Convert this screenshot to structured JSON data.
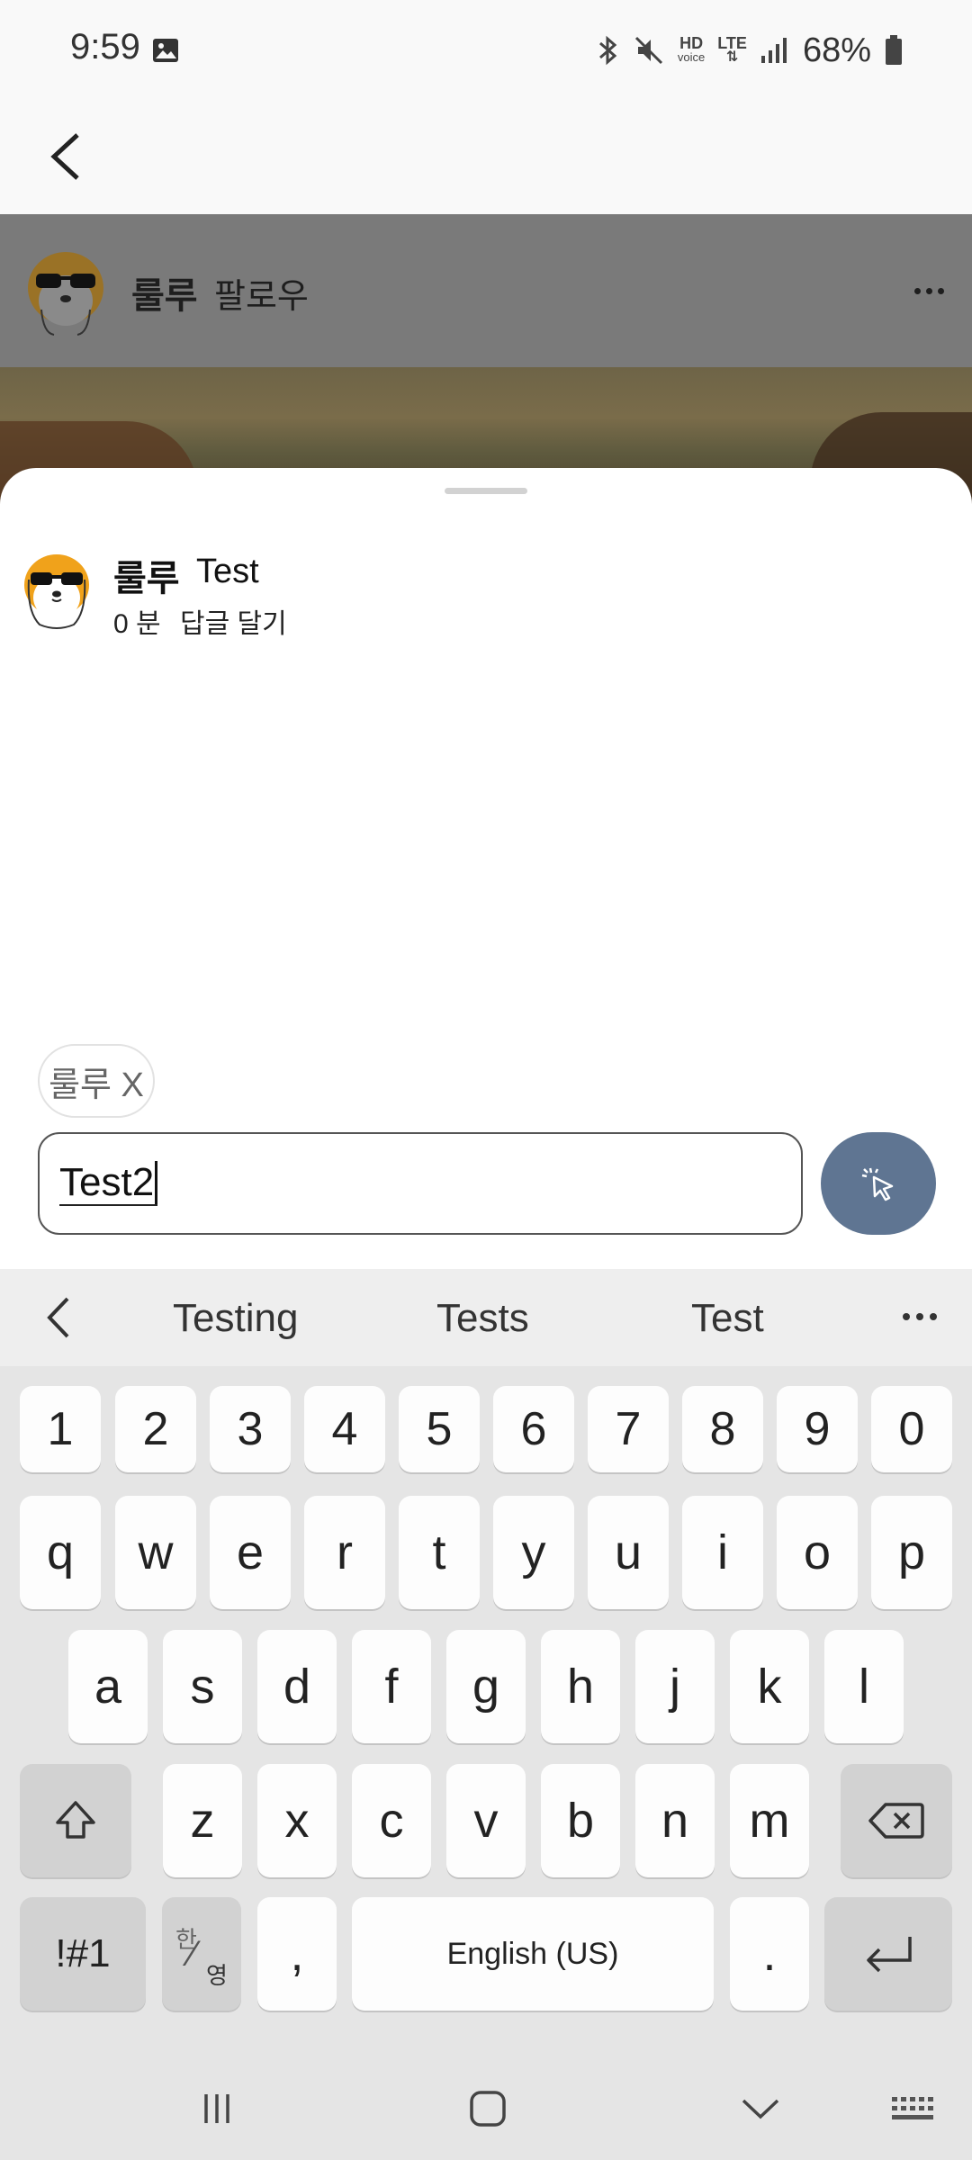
{
  "status_bar": {
    "time": "9:59",
    "hd_label": "HD",
    "voice_label": "voice",
    "lte_label": "LTE",
    "battery": "68%",
    "icons": [
      "gallery-icon",
      "bluetooth-icon",
      "mute-icon",
      "signal-icon",
      "battery-icon"
    ]
  },
  "post": {
    "author": "룰루",
    "follow_label": "팔로우"
  },
  "comment": {
    "author": "룰루",
    "text": "Test",
    "time": "0 분",
    "reply_label": "답글 달기"
  },
  "mention_chip": {
    "label": "룰루 X"
  },
  "input": {
    "value": "Test2"
  },
  "suggestions": [
    "Testing",
    "Tests",
    "Test"
  ],
  "keyboard": {
    "row_numbers": [
      "1",
      "2",
      "3",
      "4",
      "5",
      "6",
      "7",
      "8",
      "9",
      "0"
    ],
    "row1": [
      "q",
      "w",
      "e",
      "r",
      "t",
      "y",
      "u",
      "i",
      "o",
      "p"
    ],
    "row2": [
      "a",
      "s",
      "d",
      "f",
      "g",
      "h",
      "j",
      "k",
      "l"
    ],
    "row3": [
      "z",
      "x",
      "c",
      "v",
      "b",
      "n",
      "m"
    ],
    "symbols_label": "!#1",
    "lang_top": "한",
    "lang_bottom": "영",
    "comma": ",",
    "space_label": "English (US)",
    "period": "."
  },
  "colors": {
    "accent_send": "#5f7592",
    "dim_overlay": "#7a7a7a",
    "keyboard_bg": "#e5e5e5"
  }
}
